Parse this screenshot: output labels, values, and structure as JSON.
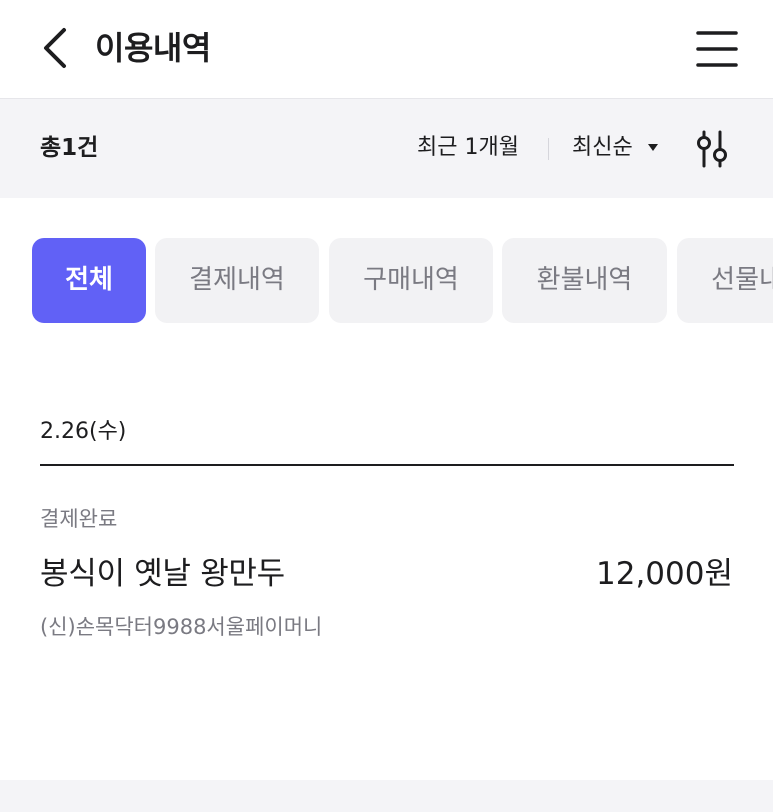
{
  "header": {
    "title": "이용내역",
    "back_icon": "chevron-left-icon",
    "menu_icon": "hamburger-menu-icon"
  },
  "filter_bar": {
    "total": "총1건",
    "period": "최근 1개월",
    "sort": "최신순",
    "sort_icon": "caret-down-icon",
    "filter_icon": "sliders-icon"
  },
  "tabs": [
    {
      "label": "전체",
      "active": true
    },
    {
      "label": "결제내역",
      "active": false
    },
    {
      "label": "구매내역",
      "active": false
    },
    {
      "label": "환불내역",
      "active": false
    },
    {
      "label": "선물내역",
      "active": false
    }
  ],
  "transactions": {
    "date": "2.26(수)",
    "items": [
      {
        "status": "결제완료",
        "name": "봉식이 옛날 왕만두",
        "amount": "12,000원",
        "merchant": "(신)손목닥터9988서울페이머니"
      }
    ]
  },
  "colors": {
    "accent": "#6161f6",
    "tab_bg": "#f2f2f4",
    "filter_bg": "#f4f4f7",
    "muted_text": "#7a7a82",
    "text": "#1d1d1f"
  }
}
